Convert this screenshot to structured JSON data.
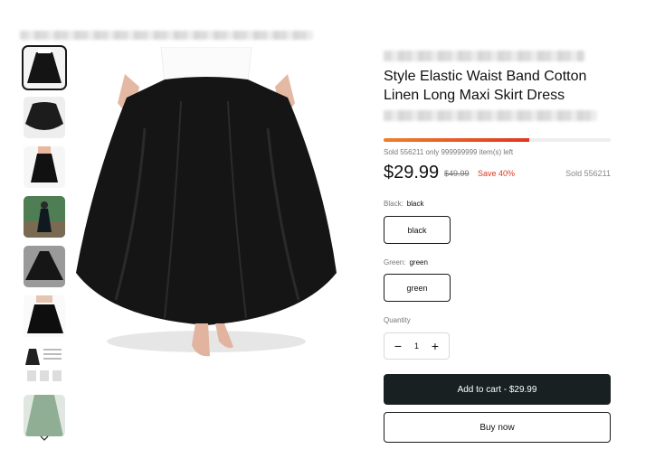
{
  "product": {
    "title": "Style Elastic Waist Band Cotton Linen Long Maxi Skirt Dress",
    "sold_left_text": "Sold 556211 only 999999999 item(s) left",
    "stock_progress": 0.64,
    "price": "$29.99",
    "compare_price": "$49.99",
    "save_text": "Save 40%",
    "sold_text": "Sold 556211"
  },
  "options": [
    {
      "name": "Black:",
      "value": "black",
      "button_label": "black"
    },
    {
      "name": "Green:",
      "value": "green",
      "button_label": "green"
    }
  ],
  "quantity": {
    "label": "Quantity",
    "value": "1",
    "minus": "−",
    "plus": "+"
  },
  "actions": {
    "add_to_cart": "Add to cart - $29.99",
    "buy_now": "Buy now"
  },
  "thumbnails": [
    "black-skirt-front",
    "black-skirt-flat",
    "black-skirt-side",
    "model-outdoor",
    "black-skirt-spread",
    "black-skirt-layout",
    "size-chart",
    "green-skirt"
  ],
  "icons": {
    "thumbs_scroll": "chevron-down-icon"
  },
  "colors": {
    "accent": "#182021",
    "sale": "#e0361f",
    "progress_start": "#f07f2a"
  }
}
